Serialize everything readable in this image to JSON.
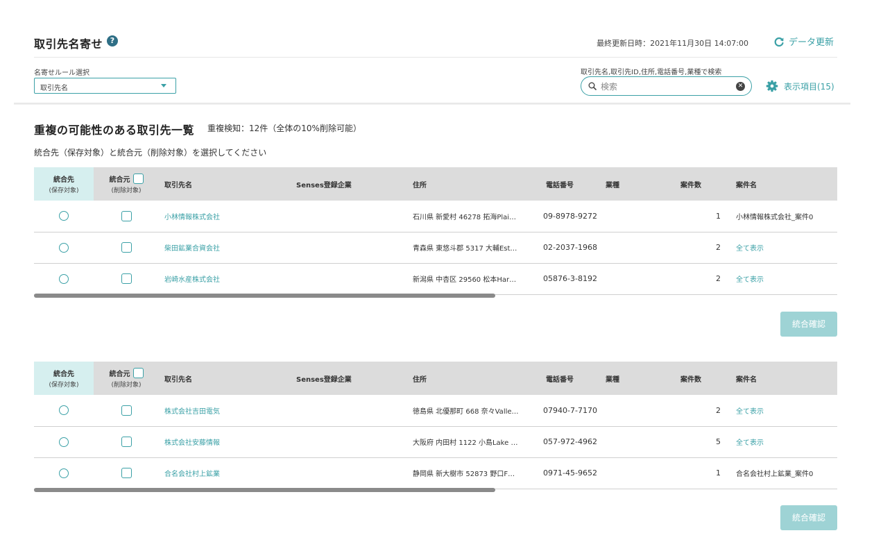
{
  "header": {
    "title": "取引先名寄せ",
    "help_icon": "question-circle-icon",
    "last_updated": "最終更新日時：2021年11月30日 14:07:00",
    "refresh_label": "データ更新",
    "refresh_icon": "refresh-icon"
  },
  "filters": {
    "rule_label": "名寄せルール選択",
    "rule_value": "取引先名",
    "search_label": "取引先名,取引先ID,住所,電話番号,業種で検索",
    "search_placeholder": "検索",
    "search_value": "",
    "columns_label": "表示項目(15)",
    "columns_icon": "gear-icon"
  },
  "list": {
    "title": "重複の可能性のある取引先一覧",
    "dup_info": "重複検知：12件（全体の10%削除可能）",
    "instruction": "統合先（保存対象）と統合元（削除対象）を選択してください"
  },
  "columns": {
    "target": "統合先",
    "target_sub": "(保存対象)",
    "source": "統合元",
    "source_sub": "(削除対象)",
    "name": "取引先名",
    "senses": "Senses登録企業",
    "address": "住所",
    "phone": "電話番号",
    "industry": "業種",
    "deals": "案件数",
    "deal_name": "案件名"
  },
  "groups": [
    {
      "rows": [
        {
          "name": "小林情報株式会社",
          "senses": "",
          "address": "石川県 新愛村 46278 拓海Plai…",
          "phone": "09-8978-9272",
          "industry": "",
          "deals": "1",
          "deal_name": "小林情報株式会社_案件0",
          "deal_is_link": false
        },
        {
          "name": "柴田鉱業合資会社",
          "senses": "",
          "address": "青森県 東悠斗郡 5317 大輔Est…",
          "phone": "02-2037-1968",
          "industry": "",
          "deals": "2",
          "deal_name": "全て表示",
          "deal_is_link": true
        },
        {
          "name": "岩崎水産株式会社",
          "senses": "",
          "address": "新潟県 中杏区 29560 松本Har…",
          "phone": "05876-3-8192",
          "industry": "",
          "deals": "2",
          "deal_name": "全て表示",
          "deal_is_link": true
        }
      ],
      "merge_label": "統合確認"
    },
    {
      "rows": [
        {
          "name": "株式会社吉田電気",
          "senses": "",
          "address": "徳島県 北優那町 668 奈々Valle…",
          "phone": "07940-7-7170",
          "industry": "",
          "deals": "2",
          "deal_name": "全て表示",
          "deal_is_link": true
        },
        {
          "name": "株式会社安藤情報",
          "senses": "",
          "address": "大阪府 内田村 1122 小島Lake …",
          "phone": "057-972-4962",
          "industry": "",
          "deals": "5",
          "deal_name": "全て表示",
          "deal_is_link": true
        },
        {
          "name": "合名会社村上鉱業",
          "senses": "",
          "address": "静岡県 新大樹市 52873 野口F…",
          "phone": "0971-45-9652",
          "industry": "",
          "deals": "1",
          "deal_name": "合名会社村上鉱業_案件0",
          "deal_is_link": false
        }
      ],
      "merge_label": "統合確認"
    }
  ],
  "colors": {
    "accent": "#3aa0a6",
    "button_disabled": "#9ed3d5",
    "header_bg": "#dcdcdc",
    "target_header_bg": "#d6efef"
  }
}
